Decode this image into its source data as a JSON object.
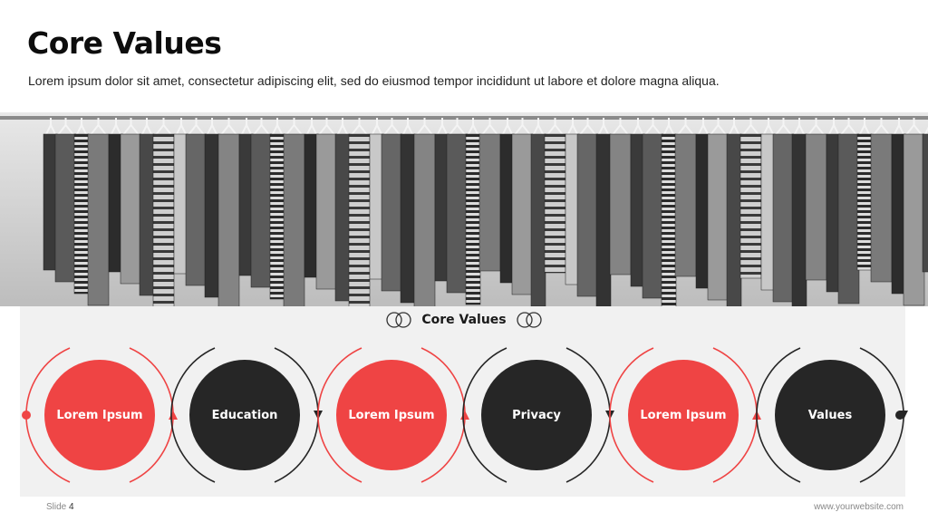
{
  "slide": {
    "title": "Core Values",
    "subtitle": "Lorem ipsum dolor sit amet, consectetur adipiscing elit, sed do eiusmod tempor incididunt ut labore et dolore magna aliqua."
  },
  "panel": {
    "title": "Core Values",
    "steps": [
      {
        "label": "Lorem Ipsum",
        "color": "red"
      },
      {
        "label": "Education",
        "color": "dark"
      },
      {
        "label": "Lorem Ipsum",
        "color": "red"
      },
      {
        "label": "Privacy",
        "color": "dark"
      },
      {
        "label": "Lorem Ipsum",
        "color": "red"
      },
      {
        "label": "Values",
        "color": "dark"
      }
    ]
  },
  "colors": {
    "accent_red": "#ef4444",
    "dark": "#262626",
    "panel_bg": "#f1f1f1"
  },
  "footer": {
    "slide_label": "Slide",
    "slide_number": "4",
    "website": "www.yourwebsite.com"
  },
  "photo": {
    "icon": "clothing-rack-photo"
  }
}
